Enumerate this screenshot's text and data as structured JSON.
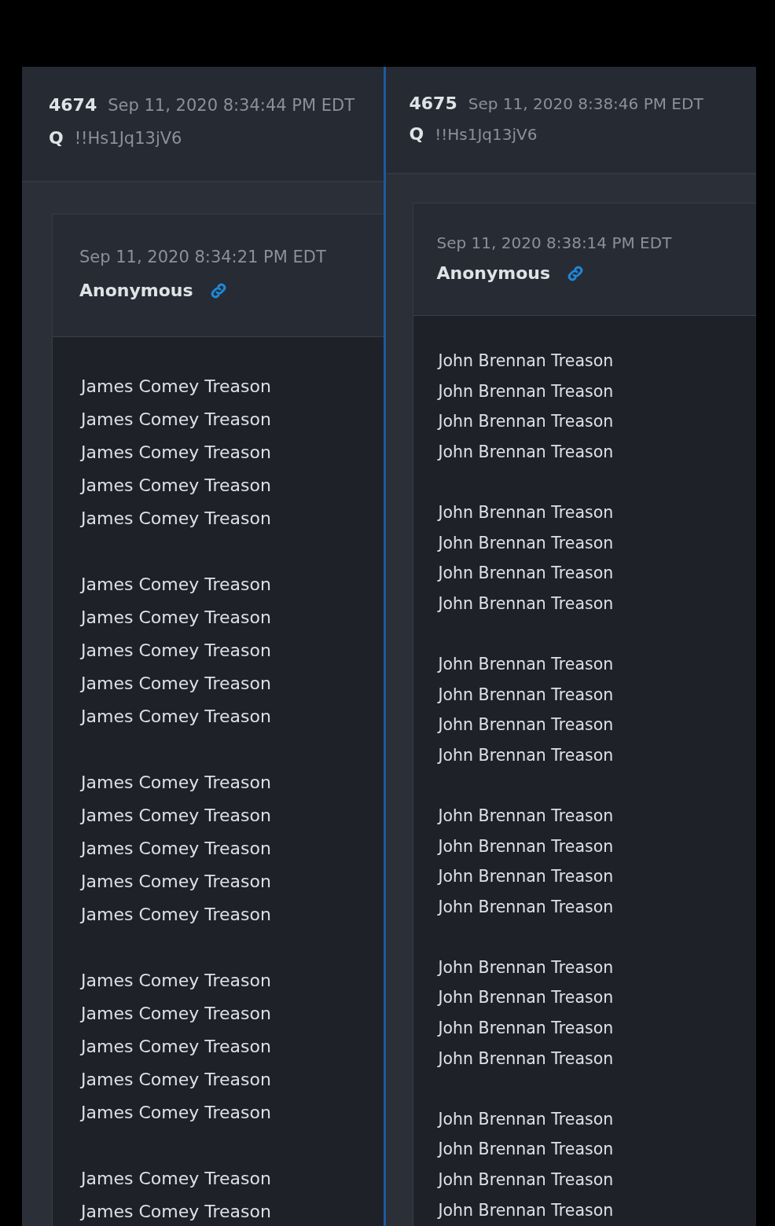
{
  "posts": [
    {
      "number": "4674",
      "time": "Sep 11, 2020 8:34:44 PM EDT",
      "author": "Q",
      "trip": "!!Hs1Jq13jV6",
      "quote": {
        "time": "Sep 11, 2020 8:34:21 PM EDT",
        "author": "Anonymous",
        "paragraphs": [
          [
            "James Comey Treason",
            "James Comey Treason",
            "James Comey Treason",
            "James Comey Treason",
            "James Comey Treason"
          ],
          [
            "James Comey Treason",
            "James Comey Treason",
            "James Comey Treason",
            "James Comey Treason",
            "James Comey Treason"
          ],
          [
            "James Comey Treason",
            "James Comey Treason",
            "James Comey Treason",
            "James Comey Treason",
            "James Comey Treason"
          ],
          [
            "James Comey Treason",
            "James Comey Treason",
            "James Comey Treason",
            "James Comey Treason",
            "James Comey Treason"
          ],
          [
            "James Comey Treason",
            "James Comey Treason"
          ]
        ]
      }
    },
    {
      "number": "4675",
      "time": "Sep 11, 2020 8:38:46 PM EDT",
      "author": "Q",
      "trip": "!!Hs1Jq13jV6",
      "quote": {
        "time": "Sep 11, 2020 8:38:14 PM EDT",
        "author": "Anonymous",
        "paragraphs": [
          [
            "John Brennan Treason",
            "John Brennan Treason",
            "John Brennan Treason",
            "John Brennan Treason"
          ],
          [
            "John Brennan Treason",
            "John Brennan Treason",
            "John Brennan Treason",
            "John Brennan Treason"
          ],
          [
            "John Brennan Treason",
            "John Brennan Treason",
            "John Brennan Treason",
            "John Brennan Treason"
          ],
          [
            "John Brennan Treason",
            "John Brennan Treason",
            "John Brennan Treason",
            "John Brennan Treason"
          ],
          [
            "John Brennan Treason",
            "John Brennan Treason",
            "John Brennan Treason",
            "John Brennan Treason"
          ],
          [
            "John Brennan Treason",
            "John Brennan Treason",
            "John Brennan Treason",
            "John Brennan Treason"
          ]
        ]
      }
    }
  ]
}
